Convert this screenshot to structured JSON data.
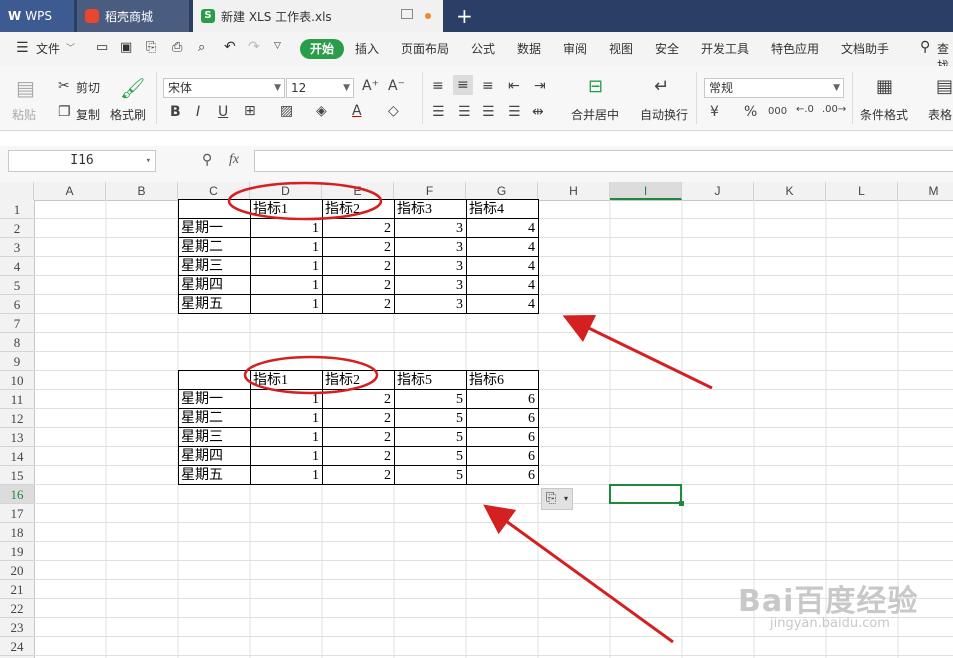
{
  "tabs": [
    {
      "label": "WPS"
    },
    {
      "label": "稻壳商城"
    },
    {
      "label": "新建 XLS 工作表.xls"
    }
  ],
  "menu": {
    "file": "文件",
    "items": [
      "开始",
      "插入",
      "页面布局",
      "公式",
      "数据",
      "审阅",
      "视图",
      "安全",
      "开发工具",
      "特色应用",
      "文档助手",
      "查找"
    ]
  },
  "ribbon": {
    "paste": "粘贴",
    "cut": "剪切",
    "copy": "复制",
    "format_painter": "格式刷",
    "font_name": "宋体",
    "font_size": "12",
    "merge_center": "合并居中",
    "wrap_text": "自动换行",
    "number_format": "常规",
    "cond_format": "条件格式",
    "table_style": "表格"
  },
  "formula_bar": {
    "name_box": "I16",
    "fx": "fx",
    "content": ""
  },
  "columns": [
    "A",
    "B",
    "C",
    "D",
    "E",
    "F",
    "G",
    "H",
    "I",
    "J",
    "K",
    "L",
    "M"
  ],
  "rows": [
    "1",
    "2",
    "3",
    "4",
    "5",
    "6",
    "7",
    "8",
    "9",
    "10",
    "11",
    "12",
    "13",
    "14",
    "15",
    "16",
    "17",
    "18",
    "19",
    "20",
    "21",
    "22",
    "23",
    "24"
  ],
  "table1": {
    "headers": [
      "",
      "指标1",
      "指标2",
      "指标3",
      "指标4"
    ],
    "rows": [
      [
        "星期一",
        "1",
        "2",
        "3",
        "4"
      ],
      [
        "星期二",
        "1",
        "2",
        "3",
        "4"
      ],
      [
        "星期三",
        "1",
        "2",
        "3",
        "4"
      ],
      [
        "星期四",
        "1",
        "2",
        "3",
        "4"
      ],
      [
        "星期五",
        "1",
        "2",
        "3",
        "4"
      ]
    ]
  },
  "table2": {
    "headers": [
      "",
      "指标1",
      "指标2",
      "指标5",
      "指标6"
    ],
    "rows": [
      [
        "星期一",
        "1",
        "2",
        "5",
        "6"
      ],
      [
        "星期二",
        "1",
        "2",
        "5",
        "6"
      ],
      [
        "星期三",
        "1",
        "2",
        "5",
        "6"
      ],
      [
        "星期四",
        "1",
        "2",
        "5",
        "6"
      ],
      [
        "星期五",
        "1",
        "2",
        "5",
        "6"
      ]
    ]
  },
  "selected_cell": "I16",
  "watermark": {
    "logo": "Bai百度经验",
    "url": "jingyan.baidu.com"
  },
  "colors": {
    "accent": "#2a9d4a",
    "annotation": "#d42020",
    "tabbar": "#2b3f66"
  }
}
